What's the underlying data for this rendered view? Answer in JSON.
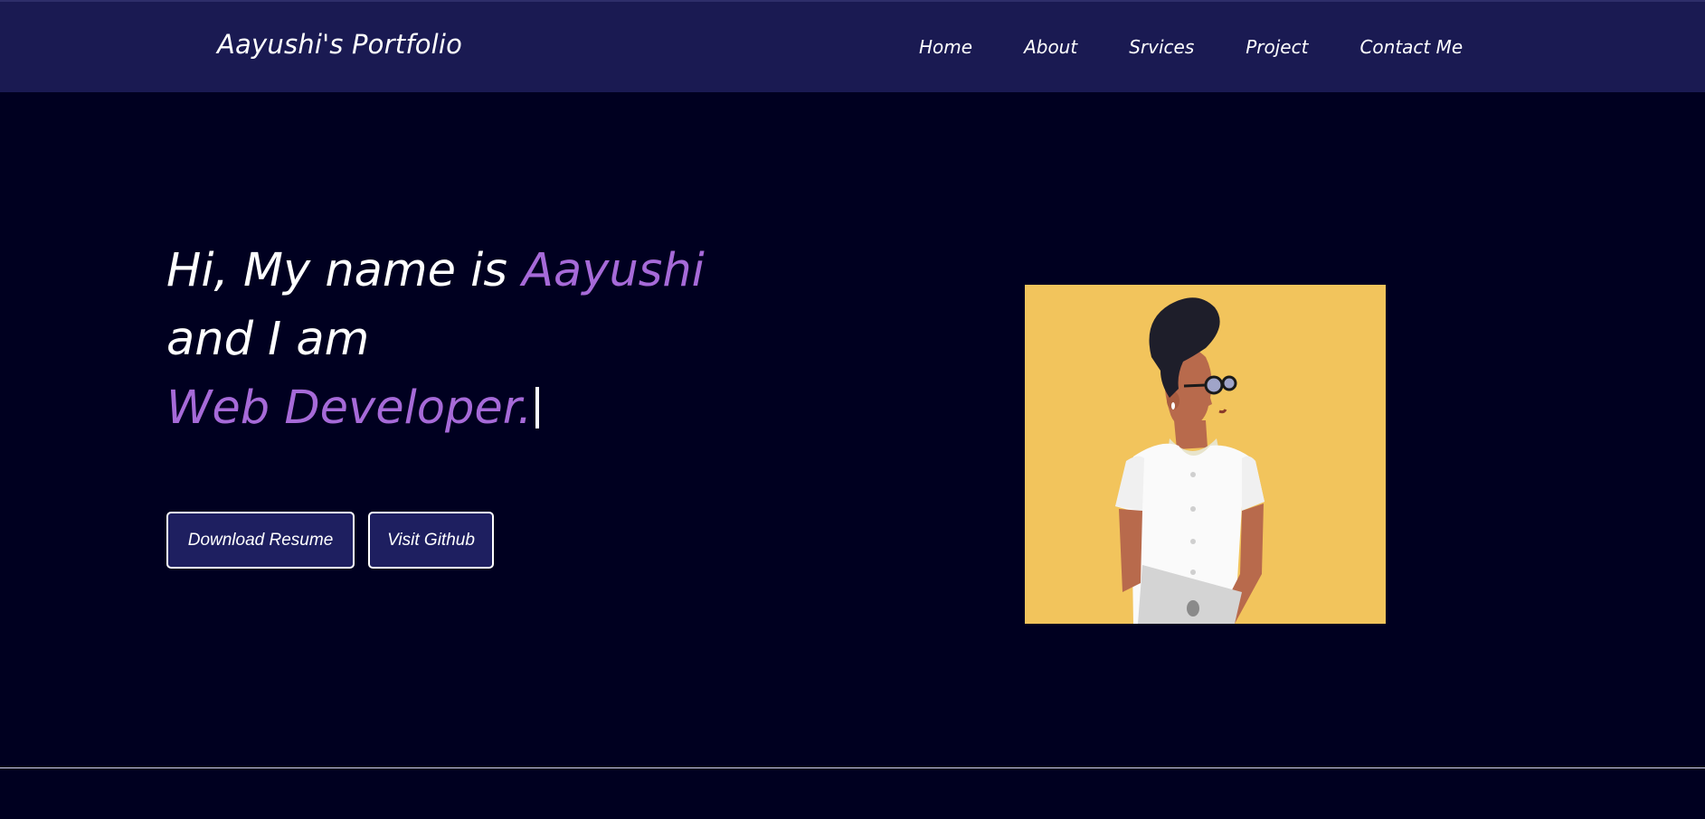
{
  "header": {
    "logo": "Aayushi's Portfolio",
    "nav": [
      {
        "label": "Home"
      },
      {
        "label": "About"
      },
      {
        "label": "Srvices"
      },
      {
        "label": "Project"
      },
      {
        "label": "Contact Me"
      }
    ]
  },
  "hero": {
    "line1_prefix": "Hi, My name is ",
    "name": "Aayushi",
    "line2": "and I am",
    "role": "Web Developer."
  },
  "buttons": {
    "resume": "Download Resume",
    "github": "Visit Github"
  },
  "colors": {
    "navbar_bg": "#1a1a52",
    "page_bg": "#000020",
    "accent": "#a66ad8",
    "button_bg": "#1e1f60",
    "illustration_bg": "#f2c45c"
  }
}
